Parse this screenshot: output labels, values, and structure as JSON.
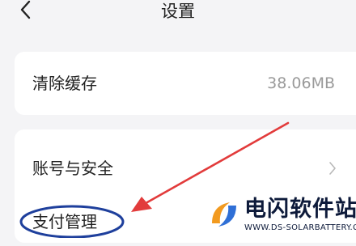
{
  "header": {
    "title": "设置"
  },
  "settings": {
    "clear_cache": {
      "label": "清除缓存",
      "value": "38.06MB"
    },
    "account_security": {
      "label": "账号与安全"
    },
    "payment_management": {
      "label": "支付管理"
    }
  },
  "watermark": {
    "name": "电闪软件站",
    "url": "WWW.DS-SOLARBATTERY.COM"
  },
  "colors": {
    "annotation_arrow": "#e23b3b",
    "annotation_circle": "#1e3f9c",
    "background": "#f4f4f6"
  },
  "icons": {
    "back": "chevron-left-icon",
    "row": "chevron-right-icon"
  }
}
